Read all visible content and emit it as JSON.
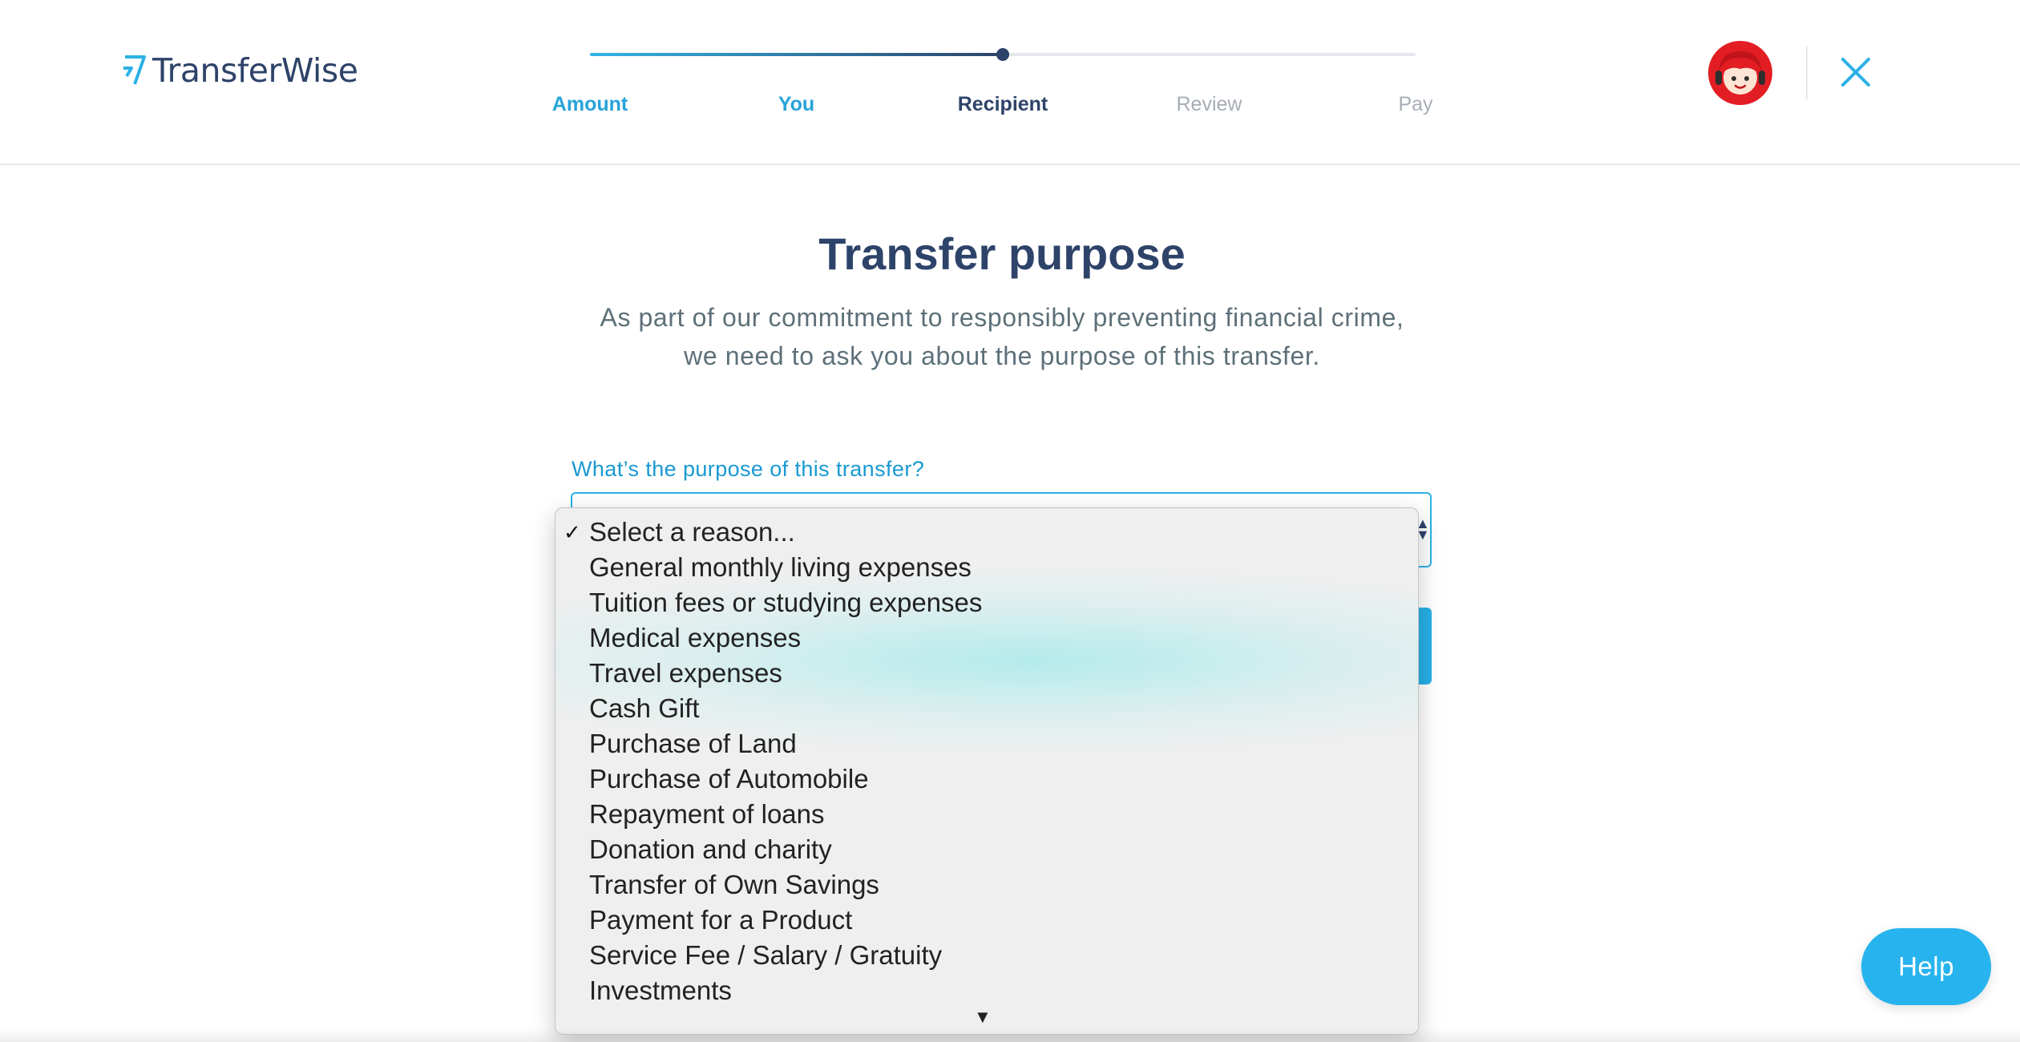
{
  "brand": {
    "name": "TransferWise",
    "accent": "#2bb1e5",
    "navy": "#2e4369"
  },
  "stepper": {
    "progress": 0.5,
    "steps": [
      {
        "label": "Amount",
        "state": "done"
      },
      {
        "label": "You",
        "state": "done"
      },
      {
        "label": "Recipient",
        "state": "current"
      },
      {
        "label": "Review",
        "state": "todo"
      },
      {
        "label": "Pay",
        "state": "todo"
      }
    ]
  },
  "header": {
    "avatar_icon": "support-agent-icon",
    "close_icon": "close-icon"
  },
  "page": {
    "title": "Transfer purpose",
    "subtitle_line1": "As part of our commitment to responsibly preventing financial crime,",
    "subtitle_line2": "we need to ask you about the purpose of this transfer."
  },
  "form": {
    "purpose_label": "What’s the purpose of this transfer?",
    "selected_index": 0,
    "options": [
      "Select a reason...",
      "General monthly living expenses",
      "Tuition fees or studying expenses",
      "Medical expenses",
      "Travel expenses",
      "Cash Gift",
      "Purchase of Land",
      "Purchase of Automobile",
      "Repayment of loans",
      "Donation and charity",
      "Transfer of Own Savings",
      "Payment for a Product",
      "Service Fee / Salary / Gratuity",
      "Investments"
    ]
  },
  "help": {
    "label": "Help"
  }
}
